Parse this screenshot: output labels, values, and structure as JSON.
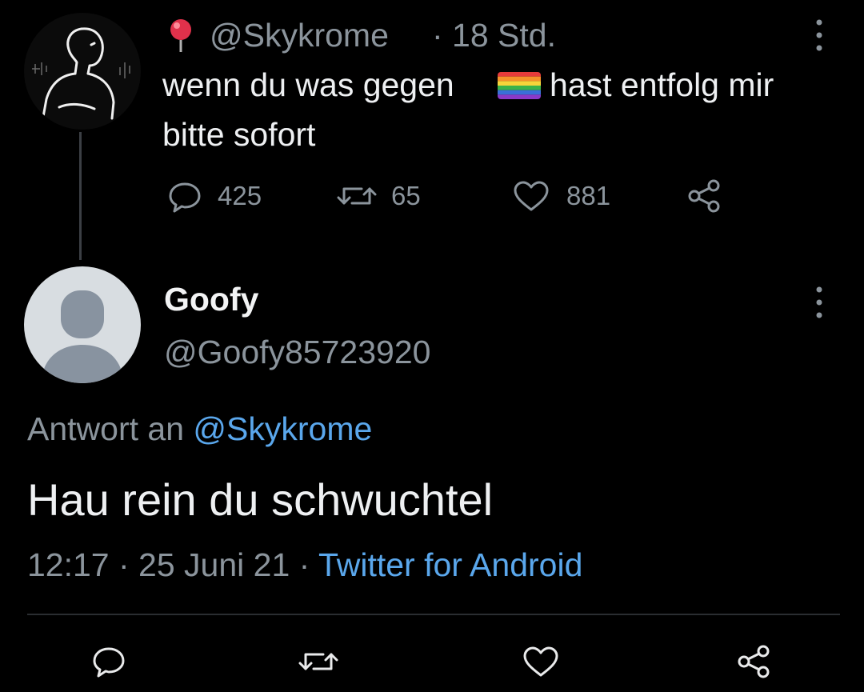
{
  "original_tweet": {
    "handle": "@Skykrome",
    "separator_time": "· 18 Std.",
    "text_before_flag": "wenn du was gegen",
    "flag_icon": "rainbow-flag-icon",
    "text_after_flag": "hast entfolg mir",
    "text_line2": "bitte sofort",
    "stats": {
      "replies": "425",
      "retweets": "65",
      "likes": "881"
    }
  },
  "reply_tweet": {
    "display_name": "Goofy",
    "handle": "@Goofy85723920",
    "reply_prefix": "Antwort an",
    "reply_mention": "@Skykrome",
    "text": "Hau rein du schwuchtel",
    "timestamp": "12:17 · 25 Juni 21 ·",
    "source": "Twitter for Android"
  },
  "colors": {
    "background": "#000000",
    "text_primary": "#eef0f2",
    "text_secondary": "#8b949c",
    "accent": "#5aa7ec"
  }
}
